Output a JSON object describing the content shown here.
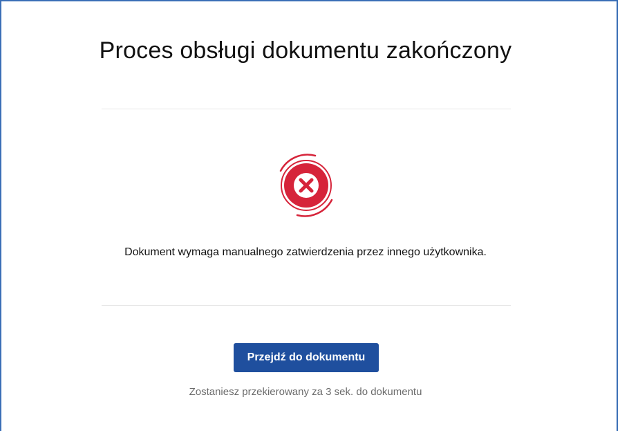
{
  "page": {
    "title": "Proces obsługi dokumentu zakończony",
    "status_icon": "error-x-icon",
    "message": "Dokument wymaga manualnego zatwierdzenia przez innego użytkownika.",
    "button_label": "Przejdź do dokumentu",
    "redirect_note": "Zostaniesz przekierowany za 3 sek. do dokumentu"
  },
  "colors": {
    "accent_error": "#d6243a",
    "button_bg": "#1f4f9e",
    "frame_border": "#3b6fb6"
  }
}
